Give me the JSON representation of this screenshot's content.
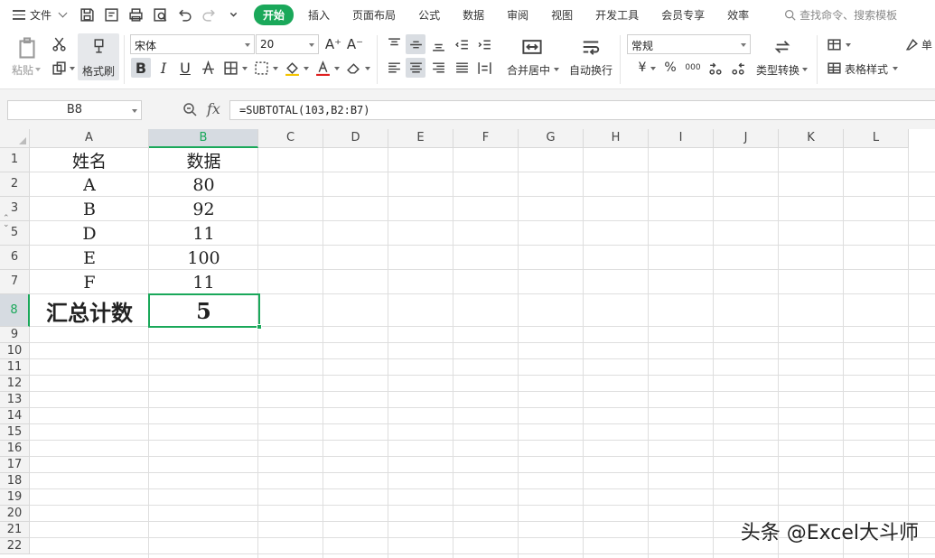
{
  "menubar": {
    "file_label": "文件",
    "tabs": [
      "开始",
      "插入",
      "页面布局",
      "公式",
      "数据",
      "审阅",
      "视图",
      "开发工具",
      "会员专享",
      "效率"
    ],
    "search_placeholder": "查找命令、搜索模板",
    "accent_color": "#1aa85a"
  },
  "ribbon": {
    "paste_label": "粘贴",
    "format_painter_label": "格式刷",
    "font_name": "宋体",
    "font_size": "20",
    "merge_center_label": "合并居中",
    "wrap_text_label": "自动换行",
    "number_format": "常规",
    "type_convert_label": "类型转换",
    "table_style_label": "表格样式",
    "cell_label_partial": "单",
    "bold_glyph": "B",
    "italic_glyph": "I",
    "underline_glyph": "U",
    "currency_glyph": "¥",
    "percent_glyph": "%",
    "thousands_glyph": "000"
  },
  "formula_bar": {
    "name_box": "B8",
    "fx_label": "fx",
    "formula": "=SUBTOTAL(103,B2:B7)"
  },
  "sheet": {
    "columns": [
      "A",
      "B",
      "C",
      "D",
      "E",
      "F",
      "G",
      "H",
      "I",
      "J",
      "K",
      "L"
    ],
    "selected_column": "B",
    "row_numbers": [
      "1",
      "2",
      "3",
      "5",
      "6",
      "7",
      "8",
      "9",
      "10",
      "11",
      "12",
      "13",
      "14",
      "15",
      "16",
      "17",
      "18",
      "19",
      "20",
      "21",
      "22"
    ],
    "selected_row": "8",
    "cells": {
      "A1": "姓名",
      "B1": "数据",
      "A2": "A",
      "B2": "80",
      "A3": "B",
      "B3": "92",
      "A5": "D",
      "B5": "11",
      "A6": "E",
      "B6": "100",
      "A7": "F",
      "B7": "11",
      "A8": "汇总计数",
      "B8": "5"
    }
  },
  "watermark": "头条 @Excel大斗师"
}
